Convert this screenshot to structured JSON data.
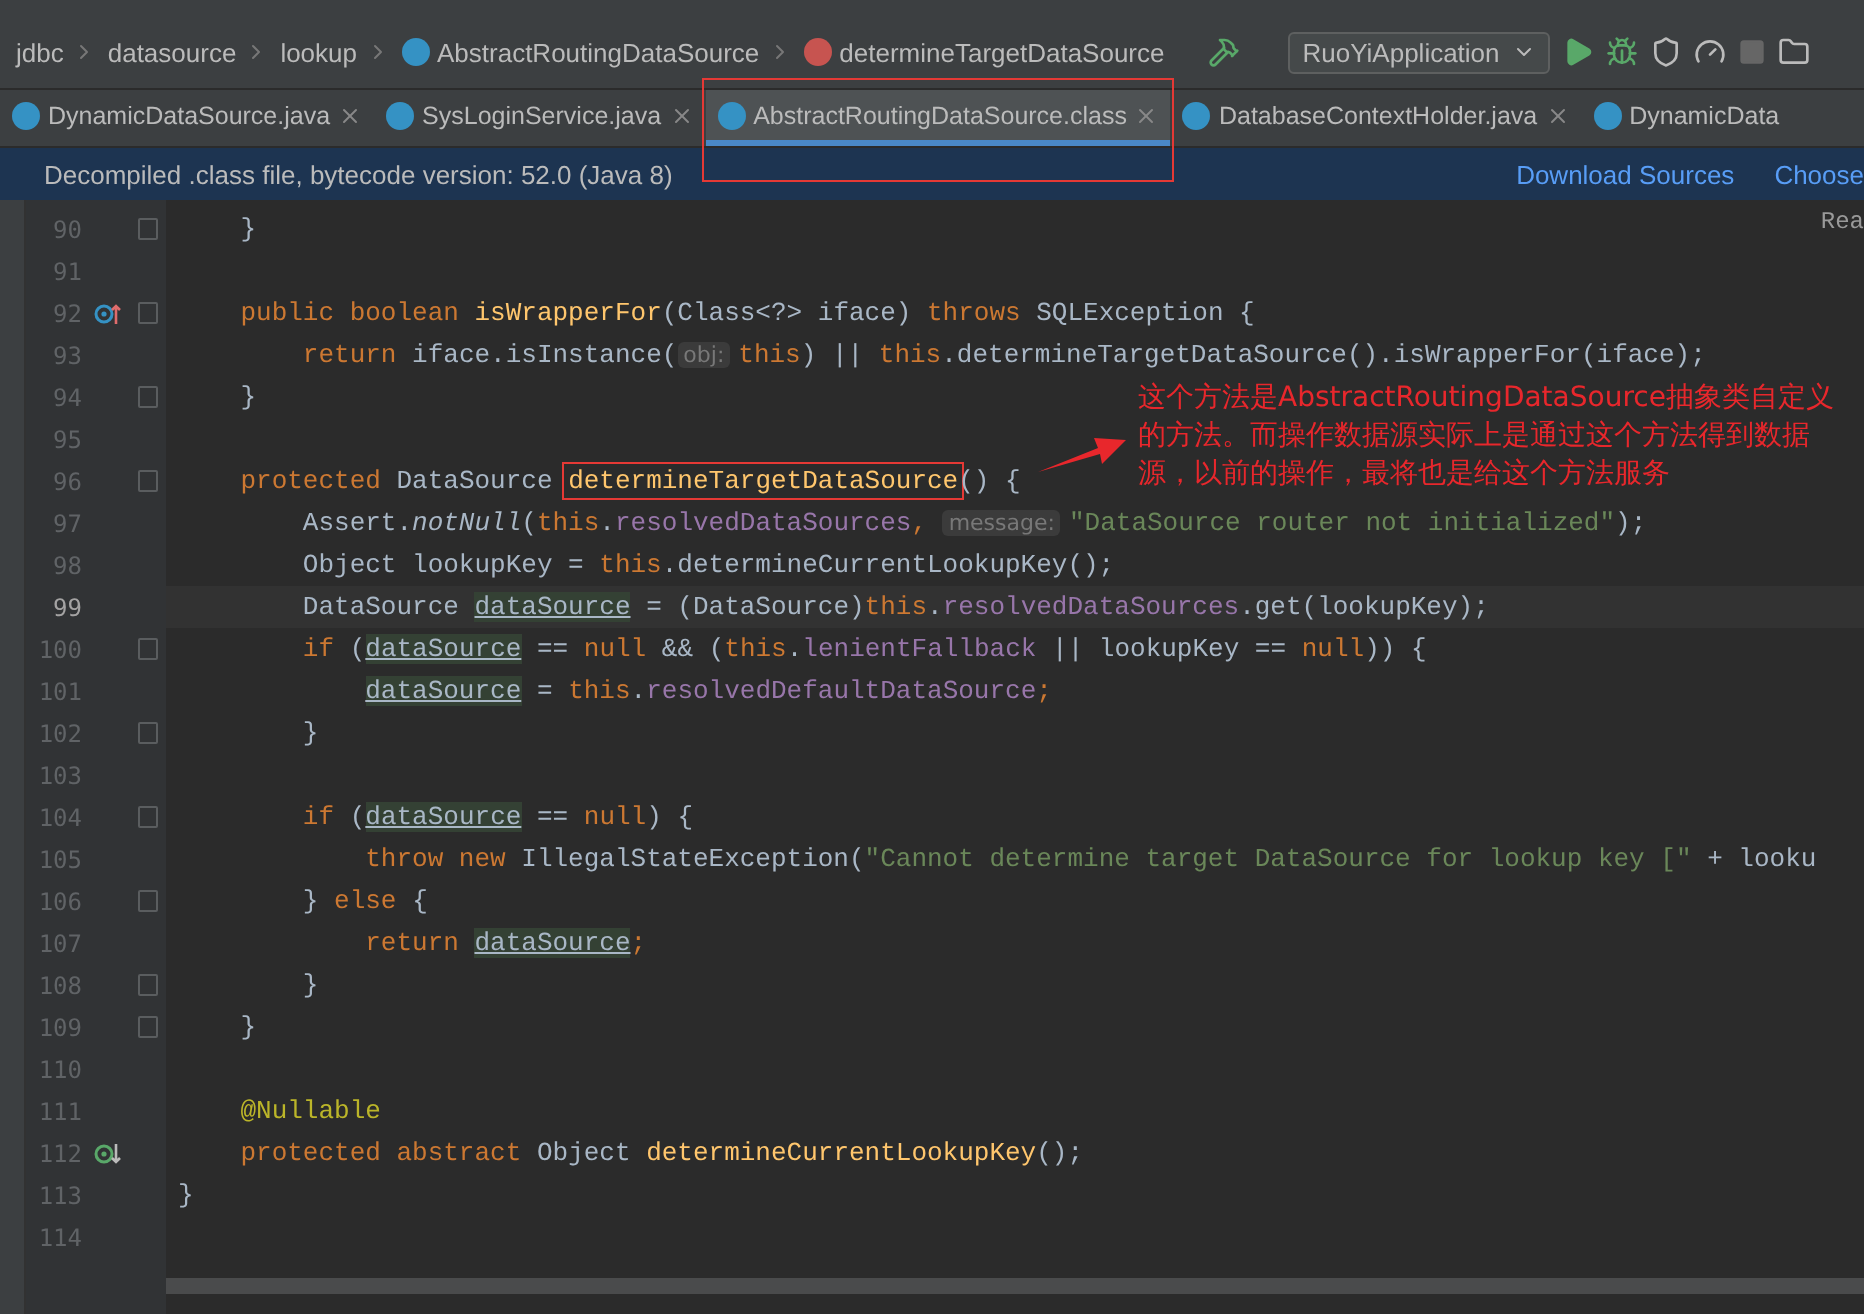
{
  "breadcrumb": {
    "items": [
      {
        "label": "jdbc",
        "kind": "package"
      },
      {
        "label": "datasource",
        "kind": "package"
      },
      {
        "label": "lookup",
        "kind": "package"
      },
      {
        "label": "AbstractRoutingDataSource",
        "kind": "class"
      },
      {
        "label": "determineTargetDataSource",
        "kind": "method"
      }
    ],
    "run_config": "RuoYiApplication"
  },
  "tabs": [
    {
      "label": "DynamicDataSource.java",
      "selected": false,
      "highlighted": false,
      "closable": true
    },
    {
      "label": "SysLoginService.java",
      "selected": false,
      "highlighted": false,
      "closable": true
    },
    {
      "label": "AbstractRoutingDataSource.class",
      "selected": true,
      "highlighted": true,
      "closable": true
    },
    {
      "label": "DatabaseContextHolder.java",
      "selected": false,
      "highlighted": false,
      "closable": true
    },
    {
      "label": "DynamicData",
      "selected": false,
      "highlighted": false,
      "closable": false
    }
  ],
  "banner": {
    "message": "Decompiled .class file, bytecode version: 52.0 (Java 8)",
    "actions": [
      "Download Sources",
      "Choose"
    ]
  },
  "editor": {
    "reader_mode": "Rea",
    "lines": [
      {
        "number": "90",
        "current": false,
        "fold": true,
        "tokens": [
          {
            "text": "    }",
            "kind": "plain"
          }
        ]
      },
      {
        "number": "91",
        "current": false,
        "fold": false
      },
      {
        "number": "92",
        "current": false,
        "fold": true,
        "kind": "override",
        "tokens": [
          {
            "text": "    public boolean ",
            "kind": "kw"
          },
          {
            "text": "isWrapperFor",
            "kind": "fn"
          },
          {
            "text": "(Class<?> iface) ",
            "kind": "plain"
          },
          {
            "text": "throws",
            "kind": "kw"
          },
          {
            "text": " SQLException {",
            "kind": "plain"
          }
        ]
      },
      {
        "number": "93",
        "current": false,
        "fold": false,
        "tokens": [
          {
            "text": "        return",
            "kind": "kw"
          },
          {
            "text": " iface.isInstance(",
            "kind": "plain"
          },
          {
            "text": "obj:",
            "kind": "hint"
          },
          {
            "text": "this",
            "kind": "kw"
          },
          {
            "text": ") || ",
            "kind": "plain"
          },
          {
            "text": "this",
            "kind": "kw"
          },
          {
            "text": ".determineTargetDataSource().isWrapperFor(iface);",
            "kind": "plain"
          }
        ]
      },
      {
        "number": "94",
        "current": false,
        "fold": true,
        "tokens": [
          {
            "text": "    }",
            "kind": "plain"
          }
        ]
      },
      {
        "number": "95",
        "current": false,
        "fold": false
      },
      {
        "number": "96",
        "current": false,
        "fold": true,
        "tokens": [
          {
            "text": "    protected",
            "kind": "kw"
          },
          {
            "text": " DataSource ",
            "kind": "plain"
          },
          {
            "text": "determineTargetDataSource",
            "kind": "fn",
            "boxed": true
          },
          {
            "text": "() {",
            "kind": "plain"
          }
        ]
      },
      {
        "number": "97",
        "current": false,
        "fold": false,
        "tokens": [
          {
            "text": "        Assert.",
            "kind": "plain"
          },
          {
            "text": "notNull",
            "kind": "italic"
          },
          {
            "text": "(",
            "kind": "plain"
          },
          {
            "text": "this",
            "kind": "kw"
          },
          {
            "text": ".",
            "kind": "plain"
          },
          {
            "text": "resolvedDataSources",
            "kind": "field"
          },
          {
            "text": ", ",
            "kind": "kw"
          },
          {
            "text": "message:",
            "kind": "hint"
          },
          {
            "text": "\"DataSource router not initialized\"",
            "kind": "str"
          },
          {
            "text": ");",
            "kind": "plain"
          }
        ]
      },
      {
        "number": "98",
        "current": false,
        "fold": false,
        "tokens": [
          {
            "text": "        Object lookupKey = ",
            "kind": "plain"
          },
          {
            "text": "this",
            "kind": "kw"
          },
          {
            "text": ".determineCurrentLookupKey();",
            "kind": "plain"
          }
        ]
      },
      {
        "number": "99",
        "current": true,
        "fold": false,
        "tokens": [
          {
            "text": "        DataSource ",
            "kind": "plain"
          },
          {
            "text": "dataSource",
            "kind": "local"
          },
          {
            "text": " = (DataSource)",
            "kind": "plain"
          },
          {
            "text": "this",
            "kind": "kw"
          },
          {
            "text": ".",
            "kind": "plain"
          },
          {
            "text": "resolvedDataSources",
            "kind": "field"
          },
          {
            "text": ".get(lookupKey);",
            "kind": "plain"
          }
        ]
      },
      {
        "number": "100",
        "current": false,
        "fold": true,
        "tokens": [
          {
            "text": "        if",
            "kind": "kw"
          },
          {
            "text": " (",
            "kind": "plain"
          },
          {
            "text": "dataSource",
            "kind": "local"
          },
          {
            "text": " == ",
            "kind": "plain"
          },
          {
            "text": "null",
            "kind": "kw"
          },
          {
            "text": " && (",
            "kind": "plain"
          },
          {
            "text": "this",
            "kind": "kw"
          },
          {
            "text": ".",
            "kind": "plain"
          },
          {
            "text": "lenientFallback",
            "kind": "field"
          },
          {
            "text": " || lookupKey == ",
            "kind": "plain"
          },
          {
            "text": "null",
            "kind": "kw"
          },
          {
            "text": ")) {",
            "kind": "plain"
          }
        ]
      },
      {
        "number": "101",
        "current": false,
        "fold": false,
        "tokens": [
          {
            "text": "            dataSource",
            "kind": "local"
          },
          {
            "text": " = ",
            "kind": "plain"
          },
          {
            "text": "this",
            "kind": "kw"
          },
          {
            "text": ".",
            "kind": "plain"
          },
          {
            "text": "resolvedDefaultDataSource",
            "kind": "field"
          },
          {
            "text": ";",
            "kind": "kw"
          }
        ]
      },
      {
        "number": "102",
        "current": false,
        "fold": true,
        "tokens": [
          {
            "text": "        }",
            "kind": "plain"
          }
        ]
      },
      {
        "number": "103",
        "current": false,
        "fold": false
      },
      {
        "number": "104",
        "current": false,
        "fold": true,
        "tokens": [
          {
            "text": "        if",
            "kind": "kw"
          },
          {
            "text": " (",
            "kind": "plain"
          },
          {
            "text": "dataSource",
            "kind": "local"
          },
          {
            "text": " == ",
            "kind": "plain"
          },
          {
            "text": "null",
            "kind": "kw"
          },
          {
            "text": ") {",
            "kind": "plain"
          }
        ]
      },
      {
        "number": "105",
        "current": false,
        "fold": false,
        "tokens": [
          {
            "text": "            throw new",
            "kind": "kw"
          },
          {
            "text": " IllegalStateException(",
            "kind": "plain"
          },
          {
            "text": "\"Cannot determine target DataSource for lookup key [\"",
            "kind": "str"
          },
          {
            "text": " + looku",
            "kind": "plain"
          }
        ]
      },
      {
        "number": "106",
        "current": false,
        "fold": true,
        "tokens": [
          {
            "text": "        } ",
            "kind": "plain"
          },
          {
            "text": "else",
            "kind": "kw"
          },
          {
            "text": " {",
            "kind": "plain"
          }
        ]
      },
      {
        "number": "107",
        "current": false,
        "fold": false,
        "tokens": [
          {
            "text": "            return ",
            "kind": "kw"
          },
          {
            "text": "dataSource",
            "kind": "local"
          },
          {
            "text": ";",
            "kind": "kw"
          }
        ]
      },
      {
        "number": "108",
        "current": false,
        "fold": true,
        "tokens": [
          {
            "text": "        }",
            "kind": "plain"
          }
        ]
      },
      {
        "number": "109",
        "current": false,
        "fold": true,
        "tokens": [
          {
            "text": "    }",
            "kind": "plain"
          }
        ]
      },
      {
        "number": "110",
        "current": false,
        "fold": false
      },
      {
        "number": "111",
        "current": false,
        "fold": false,
        "tokens": [
          {
            "text": "    @Nullable",
            "kind": "ann"
          }
        ]
      },
      {
        "number": "112",
        "current": false,
        "fold": false,
        "kind": "implemented",
        "tokens": [
          {
            "text": "    protected abstract",
            "kind": "kw"
          },
          {
            "text": " Object ",
            "kind": "plain"
          },
          {
            "text": "determineCurrentLookupKey",
            "kind": "fn"
          },
          {
            "text": "();",
            "kind": "plain"
          }
        ]
      },
      {
        "number": "113",
        "current": false,
        "fold": false,
        "tokens": [
          {
            "text": "}",
            "kind": "plain"
          }
        ]
      },
      {
        "number": "114",
        "current": false,
        "fold": false
      }
    ]
  },
  "callout": {
    "text": "这个方法是AbstractRoutingDataSource抽象类自定义的方法。而操作数据源实际上是通过这个方法得到数据源，以前的操作，最将也是给这个方法服务"
  }
}
